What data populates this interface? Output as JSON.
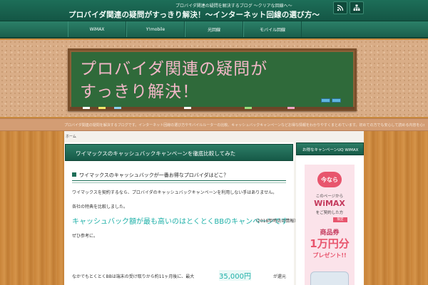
{
  "header": {
    "tagline": "プロバイダ関連の疑問を解決するブログ 〜クリアな回線へ〜",
    "site_title": "プロバイダ関連の疑問がすっきり解決！〜インターネット回線の選び方〜",
    "icons": [
      "rss-icon",
      "sitemap-icon"
    ]
  },
  "nav": {
    "items": [
      "WiMAX",
      "Y!mobile",
      "光回線",
      "モバイル回線"
    ]
  },
  "hero": {
    "line1": "プロバイダ関連の疑問が",
    "line2": "すっきり解決！"
  },
  "description": "プロバイダ関連の疑問を解決するブログです。インターネット回線の選び方やモバイルルーターの比較、キャッシュバックキャンペーンなどお得な情報をわかりやすくまとめています。初めての方でも安心して読める内容を心がけています。",
  "breadcrumb": "ホーム",
  "post": {
    "title": "ワイマックスのキャッシュバックキャンペーンを徹底比較してみた",
    "section_heading": "ワイマックスのキャッシュバックが一番お得なプロバイダはどこ？",
    "para1": "ワイマックスを契約するなら、プロバイダのキャッシュバックキャンペーンを利用しない手はありません。",
    "para2": "各社の特典を比較しました。",
    "highlight": "キャッシュバック額が最も高いのはとくとくBBのキャンペーンです",
    "highlight_tail": "（2018年時点の情報）",
    "para4": "ぜひ参考に。",
    "para5": "なかでもとくとくBBは端末の受け取りから約11ヶ月後に、最大",
    "price": "35,000円",
    "para5_tail": "が還元"
  },
  "sidebar": {
    "heading": "お得なキャンペーンUQ WiMAX",
    "ad": {
      "badge": "今なら",
      "line1": "このページから",
      "brand": "WiMAX",
      "line2": "をご契約した方",
      "tag": "限定",
      "gift": "商品券",
      "amount": "1万円分",
      "present": "プレゼント!!"
    }
  },
  "colors": {
    "header_green": "#1d6e58",
    "chalk_text": "#f2b7c7",
    "highlight_teal": "#1eb0a8",
    "ad_pink": "#e8556d"
  }
}
